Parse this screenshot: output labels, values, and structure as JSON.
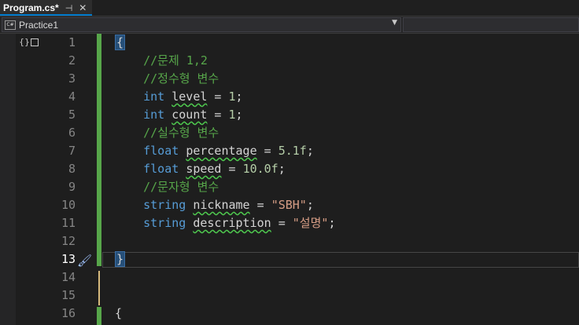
{
  "tab": {
    "title": "Program.cs*",
    "pin_icon": "pin-icon",
    "close_icon": "close-icon"
  },
  "navbar": {
    "project": "Practice1",
    "project_icon": "csharp-project-icon"
  },
  "colors": {
    "keyword": "#569cd6",
    "comment": "#57a64a",
    "number": "#b5cea8",
    "string": "#d69d85",
    "change_bar": "#57a64a",
    "accent": "#007acc"
  },
  "editor": {
    "active_line": 13,
    "lines": [
      {
        "n": "1"
      },
      {
        "n": "2"
      },
      {
        "n": "3"
      },
      {
        "n": "4"
      },
      {
        "n": "5"
      },
      {
        "n": "6"
      },
      {
        "n": "7"
      },
      {
        "n": "8"
      },
      {
        "n": "9"
      },
      {
        "n": "10"
      },
      {
        "n": "11"
      },
      {
        "n": "12"
      },
      {
        "n": "13"
      },
      {
        "n": "14"
      },
      {
        "n": "15"
      },
      {
        "n": "16"
      }
    ],
    "code": {
      "l1_brace": "{",
      "l2": "//문제 1,2",
      "l3": "//정수형 변수",
      "l4_type": "int",
      "l4_name": "level",
      "l4_rest": " = ",
      "l4_val": "1",
      "l4_end": ";",
      "l5_type": "int",
      "l5_name": "count",
      "l5_rest": " = ",
      "l5_val": "1",
      "l5_end": ";",
      "l6": "//실수형 변수",
      "l7_type": "float",
      "l7_name": "percentage",
      "l7_rest": " = ",
      "l7_val": "5.1f",
      "l7_end": ";",
      "l8_type": "float",
      "l8_name": "speed",
      "l8_rest": " = ",
      "l8_val": "10.0f",
      "l8_end": ";",
      "l9": "//문자형 변수",
      "l10_type": "string",
      "l10_name": "nickname",
      "l10_rest": " = ",
      "l10_val": "\"SBH\"",
      "l10_end": ";",
      "l11_type": "string",
      "l11_name": "description",
      "l11_rest": " = ",
      "l11_val": "\"설명\"",
      "l11_end": ";",
      "l13_brace": "}",
      "l16_brace": "{"
    }
  }
}
